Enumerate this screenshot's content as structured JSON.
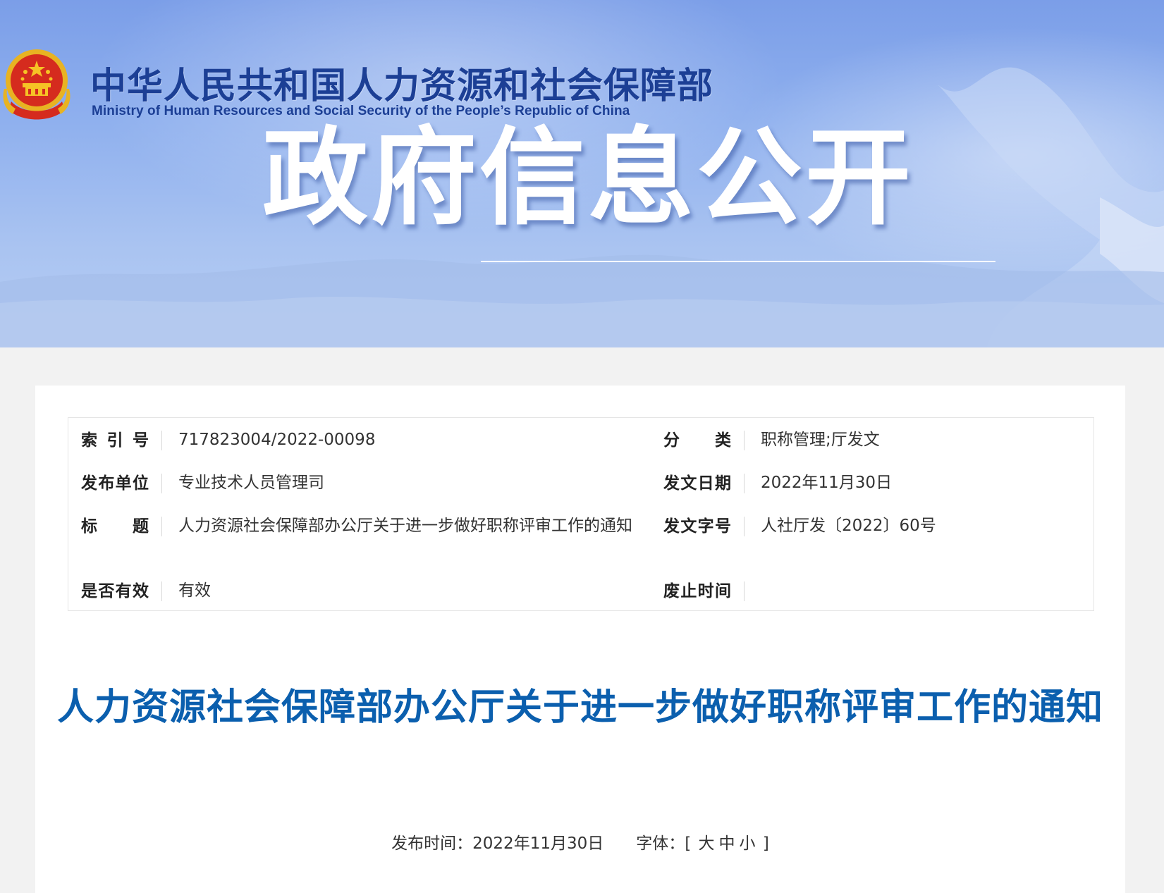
{
  "header": {
    "ministry_cn": "中华人民共和国人力资源和社会保障部",
    "ministry_en": "Ministry of Human Resources and Social Security of the People’s Republic of China",
    "banner_title": "政府信息公开"
  },
  "metadata": {
    "index_label": "索引号",
    "index_value": "717823004/2022-00098",
    "category_label": "分类",
    "category_value": "职称管理;厅发文",
    "publisher_label": "发布单位",
    "publisher_value": "专业技术人员管理司",
    "issue_date_label": "发文日期",
    "issue_date_value": "2022年11月30日",
    "title_label": "标题",
    "title_value": "人力资源社会保障部办公厅关于进一步做好职称评审工作的通知",
    "doc_number_label": "发文字号",
    "doc_number_value": "人社厅发〔2022〕60号",
    "valid_label": "是否有效",
    "valid_value": "有效",
    "abolish_label": "废止时间",
    "abolish_value": ""
  },
  "article": {
    "title": "人力资源社会保障部办公厅关于进一步做好职称评审工作的通知",
    "publish_time_label": "发布时间：",
    "publish_time_value": "2022年11月30日",
    "font_label": "字体：",
    "font_open": "[",
    "font_large": "大",
    "font_medium": "中",
    "font_small": "小",
    "font_close": "]"
  },
  "colors": {
    "title_blue": "#0b5fae",
    "ministry_blue": "#1c3f95"
  }
}
